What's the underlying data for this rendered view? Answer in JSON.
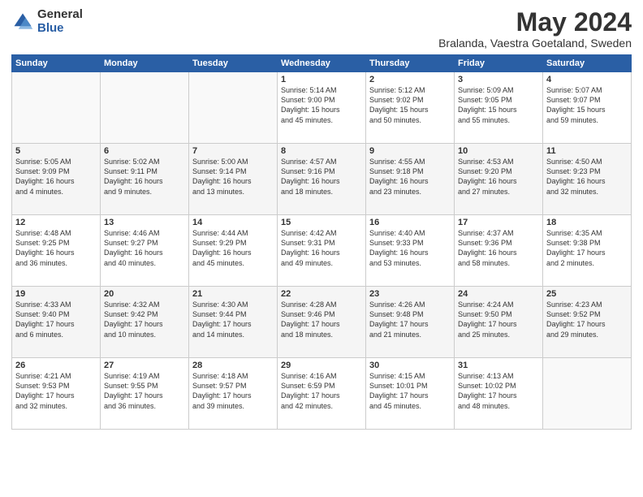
{
  "logo": {
    "general": "General",
    "blue": "Blue"
  },
  "header": {
    "month": "May 2024",
    "location": "Bralanda, Vaestra Goetaland, Sweden"
  },
  "weekdays": [
    "Sunday",
    "Monday",
    "Tuesday",
    "Wednesday",
    "Thursday",
    "Friday",
    "Saturday"
  ],
  "weeks": [
    [
      {
        "day": "",
        "info": ""
      },
      {
        "day": "",
        "info": ""
      },
      {
        "day": "",
        "info": ""
      },
      {
        "day": "1",
        "info": "Sunrise: 5:14 AM\nSunset: 9:00 PM\nDaylight: 15 hours\nand 45 minutes."
      },
      {
        "day": "2",
        "info": "Sunrise: 5:12 AM\nSunset: 9:02 PM\nDaylight: 15 hours\nand 50 minutes."
      },
      {
        "day": "3",
        "info": "Sunrise: 5:09 AM\nSunset: 9:05 PM\nDaylight: 15 hours\nand 55 minutes."
      },
      {
        "day": "4",
        "info": "Sunrise: 5:07 AM\nSunset: 9:07 PM\nDaylight: 15 hours\nand 59 minutes."
      }
    ],
    [
      {
        "day": "5",
        "info": "Sunrise: 5:05 AM\nSunset: 9:09 PM\nDaylight: 16 hours\nand 4 minutes."
      },
      {
        "day": "6",
        "info": "Sunrise: 5:02 AM\nSunset: 9:11 PM\nDaylight: 16 hours\nand 9 minutes."
      },
      {
        "day": "7",
        "info": "Sunrise: 5:00 AM\nSunset: 9:14 PM\nDaylight: 16 hours\nand 13 minutes."
      },
      {
        "day": "8",
        "info": "Sunrise: 4:57 AM\nSunset: 9:16 PM\nDaylight: 16 hours\nand 18 minutes."
      },
      {
        "day": "9",
        "info": "Sunrise: 4:55 AM\nSunset: 9:18 PM\nDaylight: 16 hours\nand 23 minutes."
      },
      {
        "day": "10",
        "info": "Sunrise: 4:53 AM\nSunset: 9:20 PM\nDaylight: 16 hours\nand 27 minutes."
      },
      {
        "day": "11",
        "info": "Sunrise: 4:50 AM\nSunset: 9:23 PM\nDaylight: 16 hours\nand 32 minutes."
      }
    ],
    [
      {
        "day": "12",
        "info": "Sunrise: 4:48 AM\nSunset: 9:25 PM\nDaylight: 16 hours\nand 36 minutes."
      },
      {
        "day": "13",
        "info": "Sunrise: 4:46 AM\nSunset: 9:27 PM\nDaylight: 16 hours\nand 40 minutes."
      },
      {
        "day": "14",
        "info": "Sunrise: 4:44 AM\nSunset: 9:29 PM\nDaylight: 16 hours\nand 45 minutes."
      },
      {
        "day": "15",
        "info": "Sunrise: 4:42 AM\nSunset: 9:31 PM\nDaylight: 16 hours\nand 49 minutes."
      },
      {
        "day": "16",
        "info": "Sunrise: 4:40 AM\nSunset: 9:33 PM\nDaylight: 16 hours\nand 53 minutes."
      },
      {
        "day": "17",
        "info": "Sunrise: 4:37 AM\nSunset: 9:36 PM\nDaylight: 16 hours\nand 58 minutes."
      },
      {
        "day": "18",
        "info": "Sunrise: 4:35 AM\nSunset: 9:38 PM\nDaylight: 17 hours\nand 2 minutes."
      }
    ],
    [
      {
        "day": "19",
        "info": "Sunrise: 4:33 AM\nSunset: 9:40 PM\nDaylight: 17 hours\nand 6 minutes."
      },
      {
        "day": "20",
        "info": "Sunrise: 4:32 AM\nSunset: 9:42 PM\nDaylight: 17 hours\nand 10 minutes."
      },
      {
        "day": "21",
        "info": "Sunrise: 4:30 AM\nSunset: 9:44 PM\nDaylight: 17 hours\nand 14 minutes."
      },
      {
        "day": "22",
        "info": "Sunrise: 4:28 AM\nSunset: 9:46 PM\nDaylight: 17 hours\nand 18 minutes."
      },
      {
        "day": "23",
        "info": "Sunrise: 4:26 AM\nSunset: 9:48 PM\nDaylight: 17 hours\nand 21 minutes."
      },
      {
        "day": "24",
        "info": "Sunrise: 4:24 AM\nSunset: 9:50 PM\nDaylight: 17 hours\nand 25 minutes."
      },
      {
        "day": "25",
        "info": "Sunrise: 4:23 AM\nSunset: 9:52 PM\nDaylight: 17 hours\nand 29 minutes."
      }
    ],
    [
      {
        "day": "26",
        "info": "Sunrise: 4:21 AM\nSunset: 9:53 PM\nDaylight: 17 hours\nand 32 minutes."
      },
      {
        "day": "27",
        "info": "Sunrise: 4:19 AM\nSunset: 9:55 PM\nDaylight: 17 hours\nand 36 minutes."
      },
      {
        "day": "28",
        "info": "Sunrise: 4:18 AM\nSunset: 9:57 PM\nDaylight: 17 hours\nand 39 minutes."
      },
      {
        "day": "29",
        "info": "Sunrise: 4:16 AM\nSunset: 6:59 PM\nDaylight: 17 hours\nand 42 minutes."
      },
      {
        "day": "30",
        "info": "Sunrise: 4:15 AM\nSunset: 10:01 PM\nDaylight: 17 hours\nand 45 minutes."
      },
      {
        "day": "31",
        "info": "Sunrise: 4:13 AM\nSunset: 10:02 PM\nDaylight: 17 hours\nand 48 minutes."
      },
      {
        "day": "",
        "info": ""
      }
    ]
  ]
}
